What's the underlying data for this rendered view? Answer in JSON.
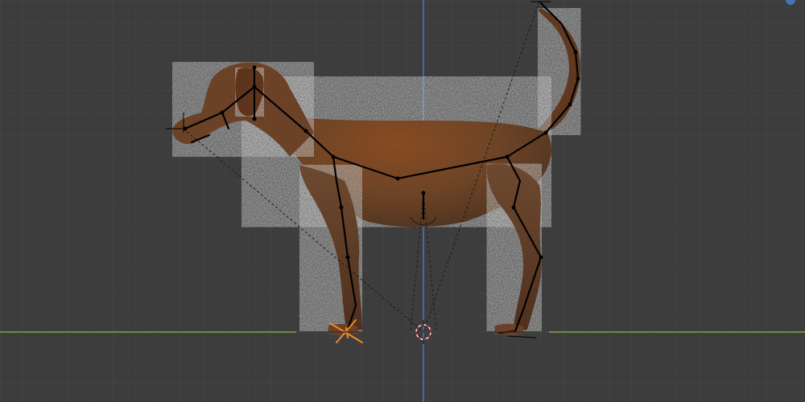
{
  "viewport": {
    "background": "#3d3d3d",
    "grid_minor_color": "#474747",
    "grid_major_color": "#4f4f4f",
    "x_axis_color": "#7fa84a",
    "z_axis_color": "#4a78c8",
    "accent_orange": "#f08a24"
  },
  "scene": {
    "object": "dog-model",
    "armature": "dog-armature",
    "active_bone_color": "#f08a24",
    "bone_color": "#000000",
    "relationship_line_style": "dashed"
  },
  "icons": {
    "cursor": "3d-cursor-icon",
    "origin": "object-origin-icon",
    "active_bone": "active-bone-icon",
    "navigation": "navigation-gizmo-icon"
  }
}
